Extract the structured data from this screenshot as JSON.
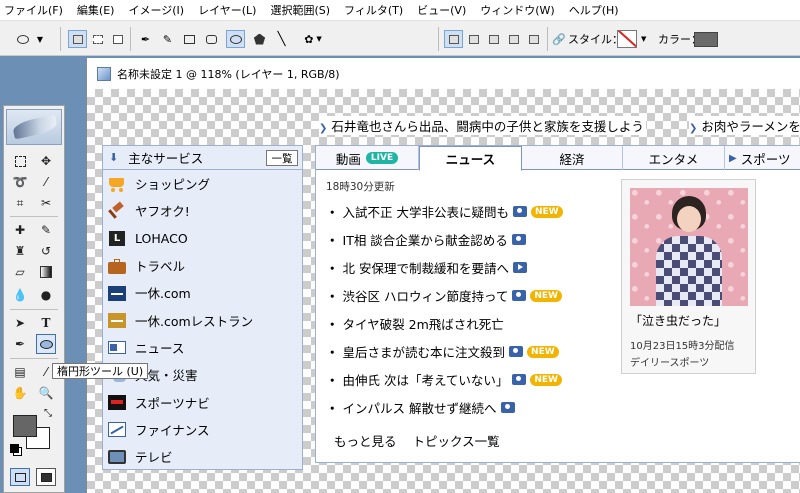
{
  "menu": [
    "ファイル(F)",
    "編集(E)",
    "イメージ(I)",
    "レイヤー(L)",
    "選択範囲(S)",
    "フィルタ(T)",
    "ビュー(V)",
    "ウィンドウ(W)",
    "ヘルプ(H)"
  ],
  "options_bar": {
    "style_label": "スタイル：",
    "color_label": "カラー：",
    "color_value": "#6a6a6a"
  },
  "toolbox": {
    "tooltip": "楕円形ツール (U)"
  },
  "document": {
    "title": "名称未設定 1 @ 118% (レイヤー 1, RGB/8)"
  },
  "ticker": {
    "item1": "石井竜也さんら出品、闘病中の子供と家族を支援しよう",
    "item2": "お肉やラーメンを"
  },
  "services": {
    "heading": "主なサービス",
    "all_button": "一覧",
    "items": [
      {
        "label": "ショッピング",
        "icon": "cart-icon"
      },
      {
        "label": "ヤフオク!",
        "icon": "auction-hammer-icon"
      },
      {
        "label": "LOHACO",
        "icon": "lohaco-icon"
      },
      {
        "label": "トラベル",
        "icon": "suitcase-icon"
      },
      {
        "label": "一休.com",
        "icon": "ikyu-icon"
      },
      {
        "label": "一休.comレストラン",
        "icon": "ikyu-restaurant-icon"
      },
      {
        "label": "ニュース",
        "icon": "news-icon"
      },
      {
        "label": "天気・災害",
        "icon": "weather-icon"
      },
      {
        "label": "スポーツナビ",
        "icon": "sportsnavi-icon"
      },
      {
        "label": "ファイナンス",
        "icon": "finance-chart-icon"
      },
      {
        "label": "テレビ",
        "icon": "tv-icon"
      }
    ]
  },
  "news": {
    "tabs": [
      {
        "label": "動画",
        "badge": "LIVE"
      },
      {
        "label": "ニュース"
      },
      {
        "label": "経済"
      },
      {
        "label": "エンタメ"
      },
      {
        "label": "スポーツ"
      }
    ],
    "updated": "18時30分更新",
    "headlines": [
      {
        "text": "入試不正 大学非公表に疑問も",
        "media": "camera",
        "new": "NEW"
      },
      {
        "text": "IT相 談合企業から献金認める",
        "media": "camera"
      },
      {
        "text": "北 安保理で制裁緩和を要請へ",
        "media": "video"
      },
      {
        "text": "渋谷区 ハロウィン節度持って",
        "media": "camera",
        "new": "NEW"
      },
      {
        "text": "タイヤ破裂 2m飛ばされ死亡",
        "media": ""
      },
      {
        "text": "皇后さまが読む本に注文殺到",
        "media": "camera",
        "new": "NEW"
      },
      {
        "text": "由伸氏 次は「考えていない」",
        "media": "camera",
        "new": "NEW"
      },
      {
        "text": "インパルス 解散せず継続へ",
        "media": "camera"
      }
    ],
    "more": "もっと見る",
    "topics": "トピックス一覧",
    "feature": {
      "caption": "「泣き虫だった」",
      "time": "10月23日15時3分配信",
      "source": "デイリースポーツ"
    }
  }
}
